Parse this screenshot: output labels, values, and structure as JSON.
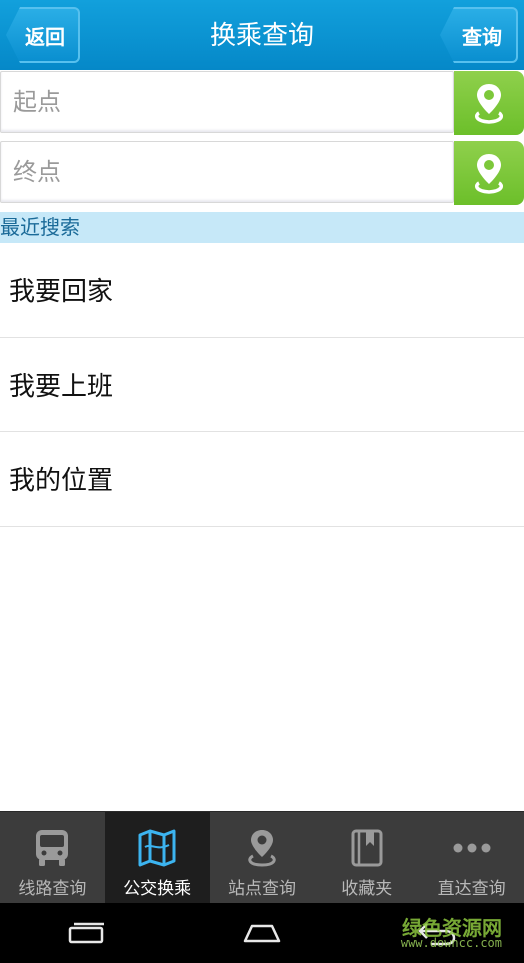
{
  "header": {
    "back_label": "返回",
    "title": "换乘查询",
    "query_label": "查询"
  },
  "inputs": {
    "start_placeholder": "起点",
    "end_placeholder": "终点"
  },
  "recent": {
    "header": "最近搜索",
    "items": [
      {
        "label": "我要回家"
      },
      {
        "label": "我要上班"
      },
      {
        "label": "我的位置"
      }
    ]
  },
  "tabs": [
    {
      "label": "线路查询",
      "icon": "bus-icon",
      "active": false
    },
    {
      "label": "公交换乘",
      "icon": "map-icon",
      "active": true
    },
    {
      "label": "站点查询",
      "icon": "location-pin-icon",
      "active": false
    },
    {
      "label": "收藏夹",
      "icon": "bookmark-icon",
      "active": false
    },
    {
      "label": "直达查询",
      "icon": "more-dots-icon",
      "active": false
    }
  ],
  "system_nav": [
    "recent-apps-icon",
    "home-icon",
    "back-icon"
  ],
  "watermark": {
    "text": "绿色资源网",
    "sub": "www.downcc.com"
  },
  "colors": {
    "header_blue": "#0a8fd0",
    "location_green": "#7cc83a",
    "recent_header_bg": "#c6e8f8",
    "tabbar_bg": "#3c3c3c",
    "active_icon_blue": "#3cb4f0"
  }
}
